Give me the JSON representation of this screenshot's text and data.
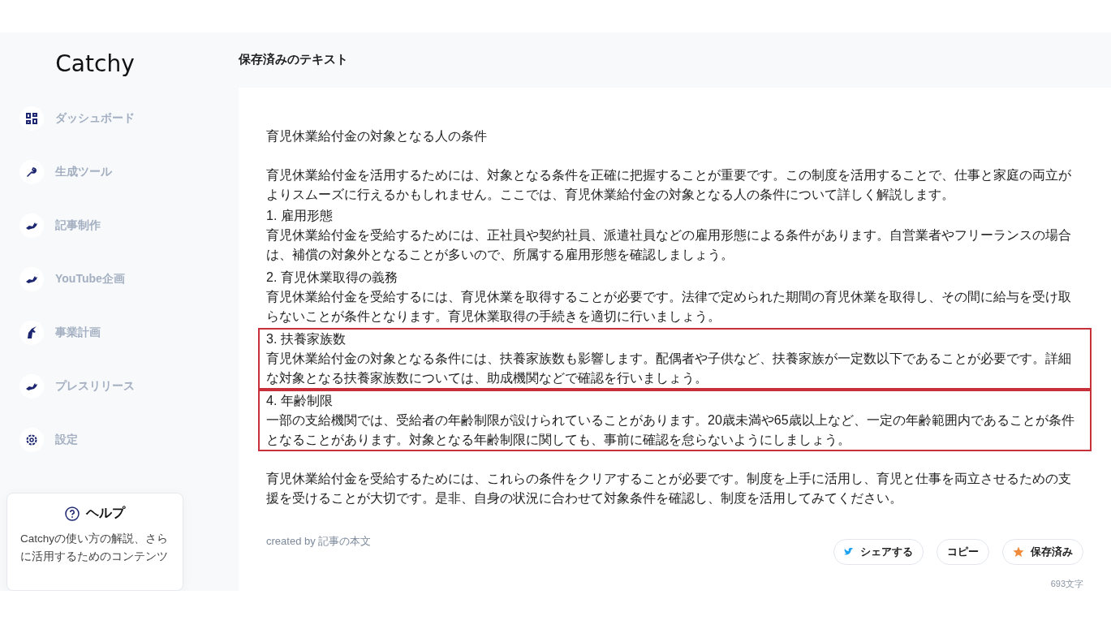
{
  "logo": "Catchy",
  "sidebar": {
    "items": [
      {
        "label": "ダッシュボード",
        "kind": "grid"
      },
      {
        "label": "生成ツール",
        "kind": "wrench"
      },
      {
        "label": "記事制作",
        "kind": "creature"
      },
      {
        "label": "YouTube企画",
        "kind": "creature"
      },
      {
        "label": "事業計画",
        "kind": "horse"
      },
      {
        "label": "プレスリリース",
        "kind": "creature"
      },
      {
        "label": "設定",
        "kind": "gear"
      }
    ]
  },
  "help": {
    "title": "ヘルプ",
    "text": "Catchyの使い方の解説、さらに活用するためのコンテンツ"
  },
  "page_title": "保存済みのテキスト",
  "article": {
    "title": "育児休業給付金の対象となる人の条件",
    "intro": "育児休業給付金を活用するためには、対象となる条件を正確に把握することが重要です。この制度を活用することで、仕事と家庭の両立がよりスムーズに行えるかもしれません。ここでは、育児休業給付金の対象となる人の条件について詳しく解説します。",
    "sections": [
      {
        "heading": "1.  雇用形態",
        "body": "育児休業給付金を受給するためには、正社員や契約社員、派遣社員などの雇用形態による条件があります。自営業者やフリーランスの場合は、補償の対象外となることが多いので、所属する雇用形態を確認しましょう。",
        "highlighted": false
      },
      {
        "heading": "2.  育児休業取得の義務",
        "body": "育児休業給付金を受給するには、育児休業を取得することが必要です。法律で定められた期間の育児休業を取得し、その間に給与を受け取らないことが条件となります。育児休業取得の手続きを適切に行いましょう。",
        "highlighted": false
      },
      {
        "heading": "3.  扶養家族数",
        "body": "育児休業給付金の対象となる条件には、扶養家族数も影響します。配偶者や子供など、扶養家族が一定数以下であることが必要です。詳細な対象となる扶養家族数については、助成機関などで確認を行いましょう。",
        "highlighted": true
      },
      {
        "heading": "4.  年齢制限",
        "body": "一部の支給機関では、受給者の年齢制限が設けられていることがあります。20歳未満や65歳以上など、一定の年齢範囲内であることが条件となることがあります。対象となる年齢制限に関しても、事前に確認を怠らないようにしましょう。",
        "highlighted": true
      }
    ],
    "conclusion": "育児休業給付金を受給するためには、これらの条件をクリアすることが必要です。制度を上手に活用し、育児と仕事を両立させるための支援を受けることが大切です。是非、自身の状況に合わせて対象条件を確認し、制度を活用してみてください。"
  },
  "created_by": {
    "label": "created by",
    "value": "記事の本文"
  },
  "buttons": [
    {
      "label": "シェアする",
      "kind": "share"
    },
    {
      "label": "コピー",
      "kind": "copy"
    },
    {
      "label": "保存済み",
      "kind": "saved"
    }
  ],
  "char_count": "693文字"
}
